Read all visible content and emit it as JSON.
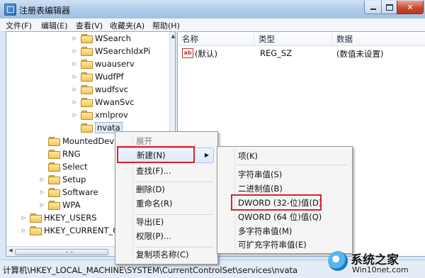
{
  "window": {
    "title": "注册表编辑器"
  },
  "menu": [
    "文件(F)",
    "编辑(E)",
    "查看(V)",
    "收藏夹(A)",
    "帮助(H)"
  ],
  "tree": [
    {
      "label": "WSearch"
    },
    {
      "label": "WSearchIdxPi"
    },
    {
      "label": "wuauserv"
    },
    {
      "label": "WudfPf"
    },
    {
      "label": "wudfsvc"
    },
    {
      "label": "WwanSvc"
    },
    {
      "label": "xmlprov"
    },
    {
      "label": "nvata",
      "selected": true
    },
    {
      "label": "MountedDev"
    },
    {
      "label": "RNG"
    },
    {
      "label": "Select"
    },
    {
      "label": "Setup"
    },
    {
      "label": "Software"
    },
    {
      "label": "WPA"
    },
    {
      "label": "HKEY_USERS"
    },
    {
      "label": "HKEY_CURRENT_CO"
    }
  ],
  "list": {
    "headers": [
      "名称",
      "类型",
      "数据"
    ],
    "rows": [
      {
        "name": "(默认)",
        "type": "REG_SZ",
        "data": "(数值未设置)",
        "icon": "string-value-icon"
      }
    ]
  },
  "context_menu": {
    "items": [
      "展开",
      "新建(N)",
      "查找(F)...",
      "删除(D)",
      "重命名(R)",
      "导出(E)",
      "权限(P)...",
      "复制项名称(C)"
    ]
  },
  "submenu": {
    "items": [
      "项(K)",
      "字符串值(S)",
      "二进制值(B)",
      "DWORD (32-位)值(D)",
      "QWORD (64 位)值(Q)",
      "多字符串值(M)",
      "可扩充字符串值(E)"
    ]
  },
  "status_bar": {
    "path": "计算机\\HKEY_LOCAL_MACHINE\\SYSTEM\\CurrentControlSet\\services\\nvata"
  },
  "watermark": {
    "brand": "系统之家",
    "site": "Win10net.com"
  },
  "colors": {
    "highlight_box": "#d9232b",
    "folder": "#f1c65a",
    "title_bar": "#aecbea"
  }
}
